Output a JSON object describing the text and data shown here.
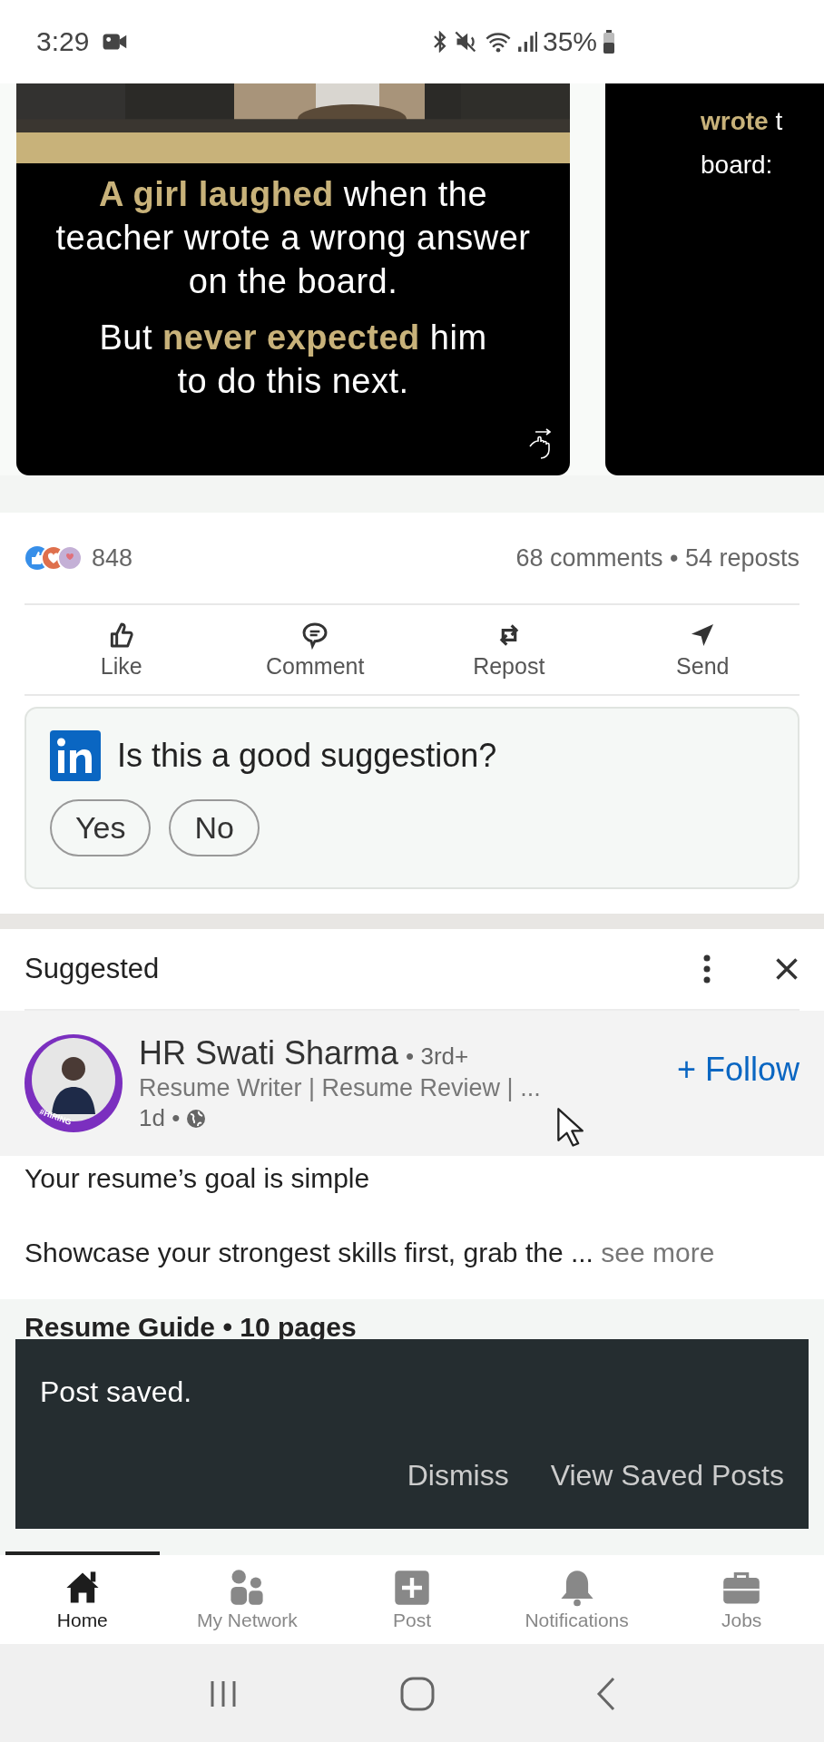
{
  "status_bar": {
    "time": "3:29",
    "battery": "35%"
  },
  "carousel": [
    {
      "paragraphs": [
        [
          "**A girl laughed** when the",
          "teacher wrote a wrong answer",
          "on the board."
        ],
        [
          "But **never expected** him",
          "to do this next."
        ]
      ]
    },
    {
      "kind": "text",
      "paragraphs": [
        [
          "**wrote** t",
          "board:"
        ]
      ]
    }
  ],
  "reactions": {
    "count": "848",
    "summary": "68 comments • 54 reposts"
  },
  "actions": [
    {
      "kind": "like",
      "label": "Like"
    },
    {
      "kind": "comment",
      "label": "Comment"
    },
    {
      "kind": "repost",
      "label": "Repost"
    },
    {
      "kind": "send",
      "label": "Send"
    }
  ],
  "suggestion_prompt": {
    "question": "Is this a good suggestion?",
    "buttons": [
      "Yes",
      "No"
    ]
  },
  "suggested": {
    "header": "Suggested",
    "author": {
      "name": "HR Swati Sharma",
      "degree": "• 3rd+",
      "headline": "Resume Writer | Resume Review | ...",
      "time": "1d •",
      "badge": "#HIRING",
      "follow": "+ Follow"
    },
    "text": [
      "Your resume’s goal is simple",
      "Showcase your strongest skills first, grab the ..."
    ],
    "see_more": "see more",
    "document_title": "Resume Guide • 10 pages"
  },
  "snackbar": {
    "message": "Post saved.",
    "actions": [
      "Dismiss",
      "View Saved Posts"
    ]
  },
  "nav": [
    {
      "kind": "home",
      "label": "Home",
      "selected": true
    },
    {
      "kind": "network",
      "label": "My Network",
      "selected": false
    },
    {
      "kind": "post",
      "label": "Post",
      "selected": false
    },
    {
      "kind": "notifications",
      "label": "Notifications",
      "selected": false
    },
    {
      "kind": "jobs",
      "label": "Jobs",
      "selected": false
    }
  ]
}
